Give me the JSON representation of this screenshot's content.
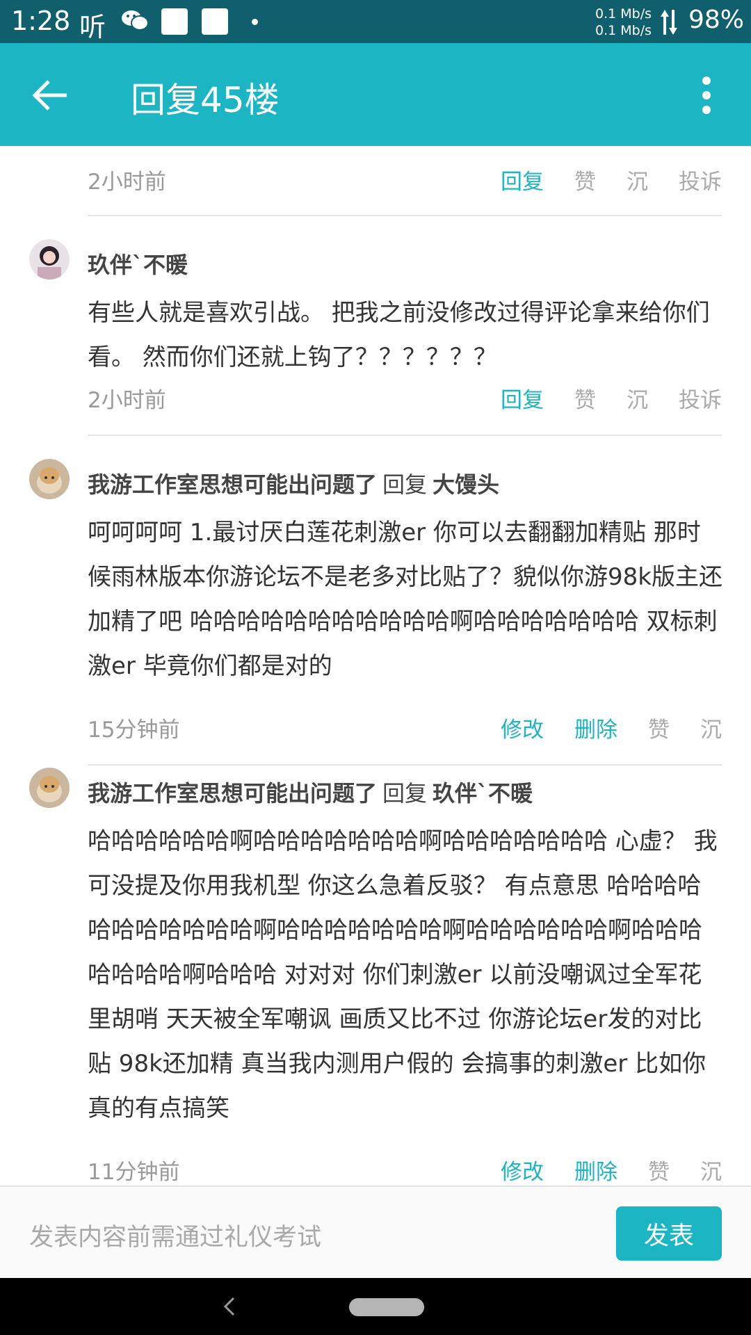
{
  "status_bar": {
    "time": "1:28",
    "listen_glyph": "听",
    "speed_up": "0.1 Mb/s",
    "speed_down": "0.1 Mb/s",
    "battery": "98%"
  },
  "toolbar": {
    "title": "回复45楼",
    "back_icon": "arrow-left-icon",
    "more_icon": "more-vert-icon"
  },
  "comments": [
    {
      "body": "",
      "time": "2小时前",
      "actions": [
        "回复",
        "赞",
        "沉",
        "投诉"
      ]
    },
    {
      "author": "玖伴`不暖",
      "body": "有些人就是喜欢引战。 把我之前没修改过得评论拿来给你们看。 然而你们还就上钩了？？？？？？",
      "time": "2小时前",
      "actions": [
        "回复",
        "赞",
        "沉",
        "投诉"
      ]
    },
    {
      "author": "我游工作室思想可能出问题了",
      "reply_word": "回复",
      "reply_to": "大馒头",
      "body": "呵呵呵呵 1.最讨厌白莲花刺激er 你可以去翻翻加精贴 那时候雨林版本你游论坛不是老多对比贴了？貌似你游98k版主还加精了吧 哈哈哈哈哈哈哈哈哈哈哈啊哈哈哈哈哈哈哈 双标刺激er 毕竟你们都是对的",
      "time": "15分钟前",
      "actions": [
        "修改",
        "删除",
        "赞",
        "沉"
      ]
    },
    {
      "author": "我游工作室思想可能出问题了",
      "reply_word": "回复",
      "reply_to": "玖伴`不暖",
      "body": "哈哈哈哈哈哈啊哈哈哈哈哈哈哈啊哈哈哈哈哈哈哈 心虚？ 我可没提及你用我机型 你这么急着反驳？ 有点意思 哈哈哈哈哈哈哈哈哈哈哈啊哈哈哈哈哈哈哈啊哈哈哈哈哈哈啊哈哈哈哈哈哈哈啊哈哈哈 对对对 你们刺激er 以前没嘲讽过全军花里胡哨 天天被全军嘲讽 画质又比不过 你游论坛er发的对比贴 98k还加精 真当我内测用户假的 会搞事的刺激er 比如你 真的有点搞笑",
      "time": "11分钟前",
      "actions": [
        "修改",
        "删除",
        "赞",
        "沉"
      ]
    }
  ],
  "input": {
    "placeholder": "发表内容前需通过礼仪考试",
    "submit_label": "发表"
  },
  "colors": {
    "accent": "#1cb5c4",
    "status_bar": "#0f5f6c",
    "muted_text": "#999999"
  }
}
